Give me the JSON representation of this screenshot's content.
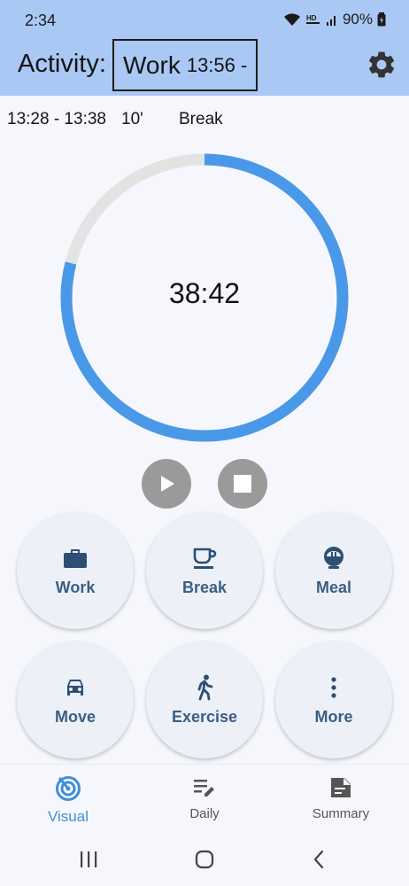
{
  "status_bar": {
    "time": "2:34",
    "battery": "90%",
    "icons": [
      "wifi-icon",
      "hd-voice-icon",
      "signal-icon",
      "battery-icon"
    ]
  },
  "header": {
    "label": "Activity:",
    "current_activity": "Work",
    "current_start": "13:56 -",
    "settings_icon": "gear-icon"
  },
  "previous": {
    "range": "13:28 - 13:38",
    "duration": "10'",
    "activity": "Break"
  },
  "timer": {
    "display": "38:42",
    "progress": 0.79
  },
  "controls": {
    "play_icon": "play-icon",
    "stop_icon": "stop-icon"
  },
  "activities": [
    {
      "label": "Work",
      "icon": "briefcase-icon"
    },
    {
      "label": "Break",
      "icon": "coffee-icon"
    },
    {
      "label": "Meal",
      "icon": "rice-bowl-icon"
    },
    {
      "label": "Move",
      "icon": "car-icon"
    },
    {
      "label": "Exercise",
      "icon": "walking-icon"
    },
    {
      "label": "More",
      "icon": "more-vertical-icon"
    }
  ],
  "bottom_nav": [
    {
      "label": "Visual",
      "icon": "radar-icon",
      "active": true
    },
    {
      "label": "Daily",
      "icon": "edit-list-icon",
      "active": false
    },
    {
      "label": "Summary",
      "icon": "note-icon",
      "active": false
    }
  ],
  "system_nav": [
    "recents-icon",
    "home-icon",
    "back-icon"
  ],
  "colors": {
    "accent": "#4a98e8",
    "header_bg": "#aac8f4",
    "track": "#e3e3e3",
    "button_text": "#3a5f82",
    "control_bg": "#9a9a9a"
  }
}
